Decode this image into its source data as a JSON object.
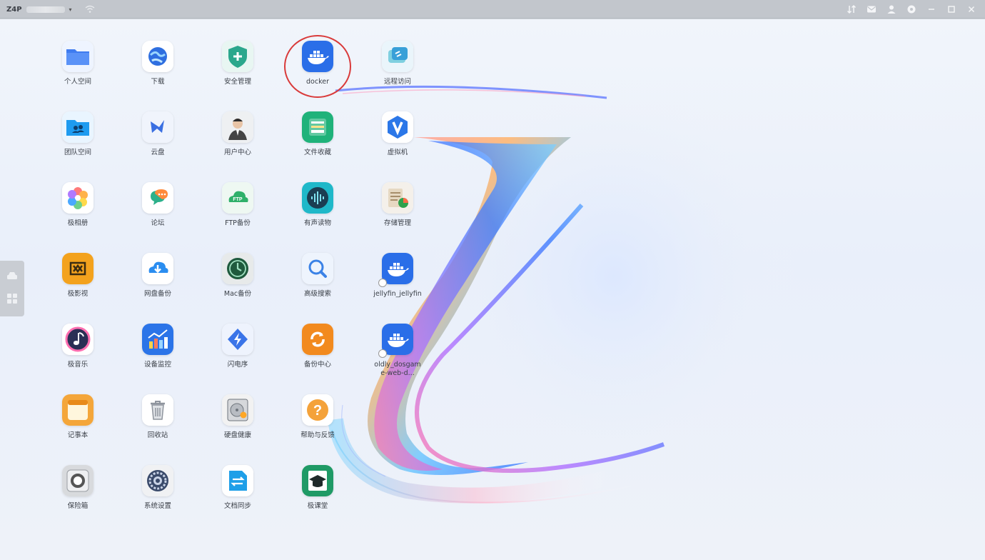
{
  "titlebar": {
    "device_name": "Z4P",
    "icons": [
      "sort-icon",
      "mail-icon",
      "user-icon",
      "settings-icon",
      "minimize-icon",
      "maximize-icon",
      "close-icon"
    ]
  },
  "sidebar_tab": {
    "icons": [
      "drive-icon",
      "grid-icon"
    ]
  },
  "apps": [
    {
      "name": "personal-space",
      "label": "个人空间",
      "icon": "folder-icon",
      "color": "#3f7cf0"
    },
    {
      "name": "download",
      "label": "下载",
      "icon": "globe-icon",
      "color": "#2f6fe0"
    },
    {
      "name": "security",
      "label": "安全管理",
      "icon": "shield-icon",
      "color": "#2ba78c"
    },
    {
      "name": "docker",
      "label": "docker",
      "icon": "docker-icon",
      "color": "#2a6ee8",
      "highlighted": true
    },
    {
      "name": "remote-access",
      "label": "远程访问",
      "icon": "link-icon",
      "color": "#39a0d8"
    },
    {
      "name": "team-space",
      "label": "团队空间",
      "icon": "team-folder-icon",
      "color": "#1e9bf0"
    },
    {
      "name": "xiaoyun",
      "label": "云盘",
      "icon": "bird-icon",
      "color": "#3a6fe2"
    },
    {
      "name": "user-center",
      "label": "用户中心",
      "icon": "person-icon",
      "color": "#444"
    },
    {
      "name": "file-collect",
      "label": "文件收藏",
      "icon": "inbox-icon",
      "color": "#1fb27a"
    },
    {
      "name": "vm",
      "label": "虚拟机",
      "icon": "vm-icon",
      "color": "#2b77e8"
    },
    {
      "name": "photos",
      "label": "极相册",
      "icon": "flower-icon",
      "color": "#f08a3c"
    },
    {
      "name": "forum",
      "label": "论坛",
      "icon": "chat-icon",
      "color": "#2db08a"
    },
    {
      "name": "ftp",
      "label": "FTP备份",
      "icon": "ftp-cloud-icon",
      "color": "#2fb06a"
    },
    {
      "name": "audio",
      "label": "有声读物",
      "icon": "waveform-icon",
      "color": "#1b3e52"
    },
    {
      "name": "storage",
      "label": "存储管理",
      "icon": "storage-chart-icon",
      "color": "#2fa14d"
    },
    {
      "name": "ziyou",
      "label": "极影视",
      "icon": "film-icon",
      "color": "#f3a21d"
    },
    {
      "name": "cloud-backup",
      "label": "网盘备份",
      "icon": "cloud-download-icon",
      "color": "#2a8df0"
    },
    {
      "name": "mac-backup",
      "label": "Mac备份",
      "icon": "time-machine-icon",
      "color": "#1f5a3d"
    },
    {
      "name": "search",
      "label": "高级搜索",
      "icon": "magnifier-icon",
      "color": "#3b82e6"
    },
    {
      "name": "jellyfin",
      "label": "jellyfin_jellyfin",
      "icon": "docker-icon",
      "color": "#2a6ee8",
      "badge": true
    },
    {
      "name": "music",
      "label": "极音乐",
      "icon": "music-icon",
      "color": "#2a2f55"
    },
    {
      "name": "monitor",
      "label": "设备监控",
      "icon": "bars-chart-icon",
      "color": "#2b74e8"
    },
    {
      "name": "flash",
      "label": "闪电序",
      "icon": "bolt-icon",
      "color": "#3a74e8"
    },
    {
      "name": "backup-center",
      "label": "备份中心",
      "icon": "sync-icon",
      "color": "#f28a1e"
    },
    {
      "name": "oldly",
      "label": "oldly_dosgame-web-d...",
      "icon": "docker-icon",
      "color": "#2a6ee8",
      "badge": true
    },
    {
      "name": "notes",
      "label": "记事本",
      "icon": "notepad-icon",
      "color": "#f4a63a"
    },
    {
      "name": "recycle",
      "label": "回收站",
      "icon": "trash-icon",
      "color": "#8f959e"
    },
    {
      "name": "disk-health",
      "label": "硬盘健康",
      "icon": "hdd-icon",
      "color": "#6f757d"
    },
    {
      "name": "help",
      "label": "帮助与反馈",
      "icon": "question-icon",
      "color": "#f4a23a"
    },
    {
      "name": "safe",
      "label": "保险箱",
      "icon": "safe-icon",
      "color": "#555"
    },
    {
      "name": "system-settings",
      "label": "系统设置",
      "icon": "gear-icon",
      "color": "#3a4a6a"
    },
    {
      "name": "file-sync",
      "label": "文档同步",
      "icon": "file-sync-icon",
      "color": "#1f9fe8"
    },
    {
      "name": "classroom",
      "label": "极课堂",
      "icon": "graduation-cap-icon",
      "color": "#1f9a66"
    }
  ]
}
